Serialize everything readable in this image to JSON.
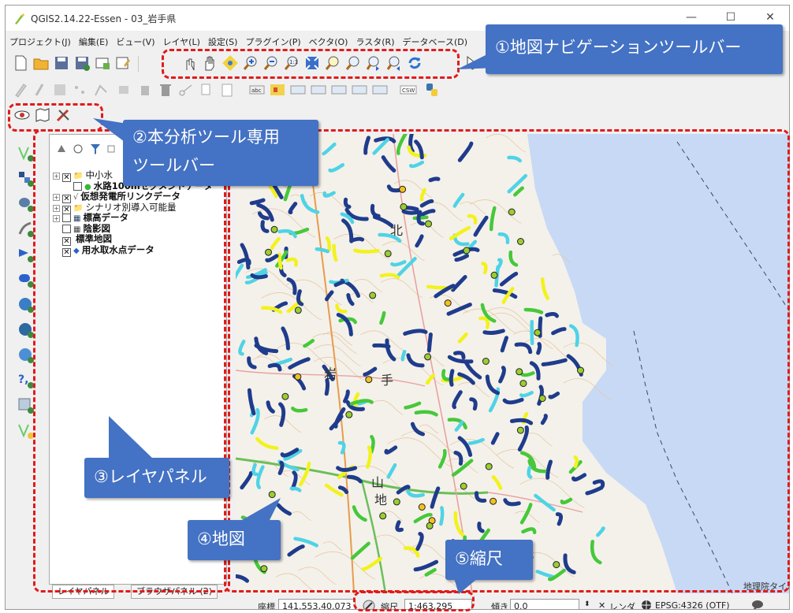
{
  "window": {
    "title": "QGIS2.14.22-Essen - 03_岩手県",
    "minimize": "—",
    "maximize": "☐",
    "close": "✕"
  },
  "menubar": {
    "items": [
      "プロジェクト(J)",
      "編集(E)",
      "ビュー(V)",
      "レイヤ(L)",
      "設定(S)",
      "プラグイン(P)",
      "ベクタ(O)",
      "ラスタ(R)",
      "データベース(D)"
    ]
  },
  "layer_panel": {
    "header_letter": "レ",
    "layers": [
      {
        "label": "中小水",
        "checked": true,
        "expand": "+",
        "indent": 0,
        "bold": false
      },
      {
        "label": "水路100mセグメントデータ",
        "checked": false,
        "expand": "",
        "indent": 1,
        "bold": true
      },
      {
        "label": "仮想発電所リンクデータ",
        "checked": true,
        "expand": "+",
        "indent": 0,
        "bold": true
      },
      {
        "label": "シナリオ別導入可能量",
        "checked": true,
        "expand": "+",
        "indent": 0,
        "bold": false
      },
      {
        "label": "標高データ",
        "checked": false,
        "expand": "+",
        "indent": 0,
        "bold": true
      },
      {
        "label": "陰影図",
        "checked": false,
        "expand": "",
        "indent": 0,
        "bold": true
      },
      {
        "label": "標準地図",
        "checked": true,
        "expand": "",
        "indent": 0,
        "bold": true
      },
      {
        "label": "用水取水点データ",
        "checked": true,
        "expand": "",
        "indent": 0,
        "bold": true
      }
    ],
    "tabs": [
      "レイヤパネル",
      "ブラウザパネル (2)"
    ]
  },
  "map": {
    "attribution": "地理院タイル",
    "labels": [
      "北",
      "岩",
      "手",
      "山",
      "地"
    ],
    "colors": {
      "sea": "#c7d9f5",
      "land": "#f4f1ea",
      "river_dark": "#1f3c8c",
      "river_light": "#4fd3e6",
      "river_green": "#46c83a",
      "river_yellow": "#f2f21d"
    }
  },
  "statusbar": {
    "coord_label": "座標",
    "coord_value": "141.553,40.073",
    "scale_label": "縮尺",
    "scale_value": "1:463,295",
    "rotation_label": "傾き",
    "rotation_value": "0.0",
    "render_label": "レンダ",
    "crs": "EPSG:4326 (OTF)"
  },
  "annotations": {
    "nav_toolbar": "①地図ナビゲーションツールバー",
    "analysis_toolbar_line1": "②本分析ツール専用",
    "analysis_toolbar_line2": "ツールバー",
    "layer_panel": "③レイヤパネル",
    "map": "④地図",
    "scale": "⑤縮尺",
    "accent": "#4472c4",
    "dash_color": "#e01b1b"
  }
}
